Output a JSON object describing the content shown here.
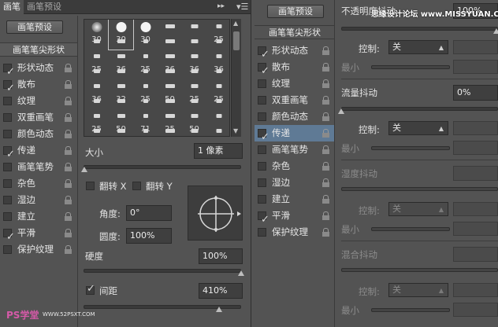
{
  "left_panel": {
    "tabs": [
      "画笔",
      "画笔预设"
    ],
    "preset_button": "画笔预设",
    "section_header": "画笔笔尖形状",
    "options": [
      {
        "label": "形状动态",
        "checked": true,
        "locked": true
      },
      {
        "label": "散布",
        "checked": true,
        "locked": true
      },
      {
        "label": "纹理",
        "checked": false,
        "locked": true
      },
      {
        "label": "双重画笔",
        "checked": false,
        "locked": true
      },
      {
        "label": "颜色动态",
        "checked": false,
        "locked": true
      },
      {
        "label": "传递",
        "checked": true,
        "locked": true
      },
      {
        "label": "画笔笔势",
        "checked": false,
        "locked": true
      },
      {
        "label": "杂色",
        "checked": false,
        "locked": true
      },
      {
        "label": "湿边",
        "checked": false,
        "locked": true
      },
      {
        "label": "建立",
        "checked": false,
        "locked": true
      },
      {
        "label": "平滑",
        "checked": true,
        "locked": true
      },
      {
        "label": "保护纹理",
        "checked": false,
        "locked": true
      }
    ],
    "brush_sizes": [
      "30",
      "30",
      "30",
      "",
      "",
      "25",
      "",
      "",
      "",
      "",
      "",
      "",
      "25",
      "36",
      "25",
      "36",
      "36",
      "36",
      "",
      "",
      "",
      "",
      "",
      "",
      "36",
      "32",
      "25",
      "50",
      "25",
      "25",
      "",
      "",
      "",
      "",
      "",
      "",
      "25",
      "50",
      "71",
      "25",
      "50",
      "",
      "",
      "",
      "",
      "",
      "",
      ""
    ],
    "size_label": "大小",
    "size_value": "1 像素",
    "flip_x_label": "翻转 X",
    "flip_y_label": "翻转 Y",
    "angle_label": "角度:",
    "angle_value": "0°",
    "roundness_label": "圆度:",
    "roundness_value": "100%",
    "hardness_label": "硬度",
    "hardness_value": "100%",
    "spacing_label": "间距",
    "spacing_value": "410%",
    "spacing_checked": true,
    "watermark_left": "PS学堂",
    "watermark_right": "WWW.52PSXT.COM"
  },
  "middle_panel": {
    "preset_button": "画笔预设",
    "section_header": "画笔笔尖形状",
    "options": [
      {
        "label": "形状动态",
        "checked": true,
        "locked": true
      },
      {
        "label": "散布",
        "checked": true,
        "locked": true
      },
      {
        "label": "纹理",
        "checked": false,
        "locked": true
      },
      {
        "label": "双重画笔",
        "checked": false,
        "locked": true
      },
      {
        "label": "颜色动态",
        "checked": false,
        "locked": true
      },
      {
        "label": "传递",
        "checked": true,
        "locked": true,
        "selected": true
      },
      {
        "label": "画笔笔势",
        "checked": false,
        "locked": true
      },
      {
        "label": "杂色",
        "checked": false,
        "locked": true
      },
      {
        "label": "湿边",
        "checked": false,
        "locked": true
      },
      {
        "label": "建立",
        "checked": false,
        "locked": true
      },
      {
        "label": "平滑",
        "checked": true,
        "locked": true
      },
      {
        "label": "保护纹理",
        "checked": false,
        "locked": true
      }
    ]
  },
  "right_panel": {
    "opacity_jitter_label": "不透明度抖动",
    "opacity_jitter_value": "100%",
    "control_label": "控制:",
    "control_value": "关",
    "min_label": "最小",
    "flow_jitter_label": "流量抖动",
    "flow_jitter_value": "0%",
    "flow_control_label": "控制:",
    "flow_control_value": "关",
    "flow_min_label": "最小",
    "wetness_jitter_label": "湿度抖动",
    "wetness_control_label": "控制:",
    "wetness_control_value": "关",
    "wetness_min_label": "最小",
    "mix_jitter_label": "混合抖动",
    "mix_control_label": "控制:",
    "mix_control_value": "关",
    "mix_min_label": "最小",
    "watermark": "思缘设计论坛 www.MISSYUAN.COM"
  }
}
